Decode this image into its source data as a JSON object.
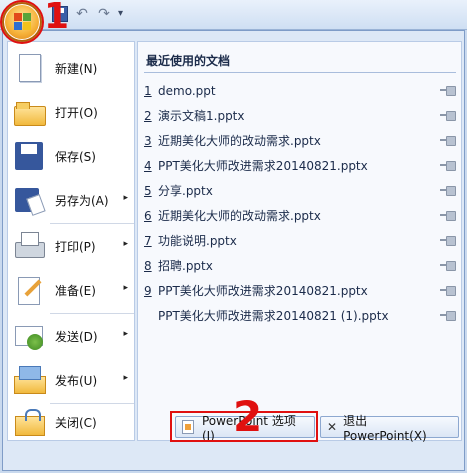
{
  "annotations": {
    "marker_1": "1",
    "marker_2": "2"
  },
  "quick_access": {
    "undo_glyph": "↶",
    "redo_glyph": "↷",
    "more_glyph": "▾"
  },
  "commands": [
    {
      "label": "新建(N)",
      "icon": "new-document-icon",
      "has_submenu": false
    },
    {
      "label": "打开(O)",
      "icon": "open-folder-icon",
      "has_submenu": false
    },
    {
      "label": "保存(S)",
      "icon": "save-disk-icon",
      "has_submenu": false
    },
    {
      "label": "另存为(A)",
      "icon": "save-as-icon",
      "has_submenu": true
    },
    {
      "label": "打印(P)",
      "icon": "printer-icon",
      "has_submenu": true
    },
    {
      "label": "准备(E)",
      "icon": "prepare-document-icon",
      "has_submenu": true
    },
    {
      "label": "发送(D)",
      "icon": "send-icon",
      "has_submenu": true
    },
    {
      "label": "发布(U)",
      "icon": "publish-icon",
      "has_submenu": true
    },
    {
      "label": "关闭(C)",
      "icon": "close-folder-icon",
      "has_submenu": false
    }
  ],
  "submenu_arrow": "▸",
  "recent": {
    "title": "最近使用的文档",
    "docs": [
      {
        "num": "1",
        "name": "demo.ppt"
      },
      {
        "num": "2",
        "name": "演示文稿1.pptx"
      },
      {
        "num": "3",
        "name": "近期美化大师的改动需求.pptx"
      },
      {
        "num": "4",
        "name": "PPT美化大师改进需求20140821.pptx"
      },
      {
        "num": "5",
        "name": "分享.pptx"
      },
      {
        "num": "6",
        "name": "近期美化大师的改动需求.pptx"
      },
      {
        "num": "7",
        "name": "功能说明.pptx"
      },
      {
        "num": "8",
        "name": "招聘.pptx"
      },
      {
        "num": "9",
        "name": "PPT美化大师改进需求20140821.pptx"
      },
      {
        "num": "",
        "name": "PPT美化大师改进需求20140821 (1).pptx"
      }
    ]
  },
  "buttons": {
    "options_label": "PowerPoint 选项(I)",
    "exit_label": "退出 PowerPoint(X)",
    "exit_glyph": "✕"
  },
  "colors": {
    "annotation_red": "#e01010",
    "panel_blue": "#dde8f6"
  }
}
